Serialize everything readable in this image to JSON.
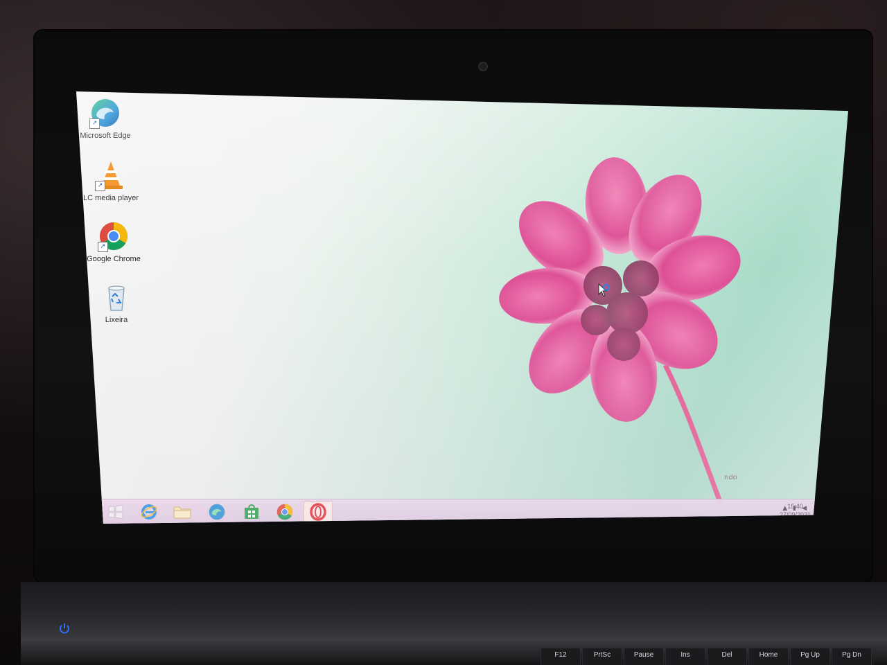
{
  "desktop": {
    "icons": [
      {
        "label": "Microsoft Edge",
        "icon": "edge-icon"
      },
      {
        "label": "LC media player",
        "icon": "vlc-icon"
      },
      {
        "label": "Google Chrome",
        "icon": "chrome-icon"
      },
      {
        "label": "Lixeira",
        "icon": "recycle-bin-icon"
      }
    ],
    "watermark": "ndo"
  },
  "taskbar": {
    "buttons": [
      {
        "name": "start-button",
        "icon": "windows-logo-icon"
      },
      {
        "name": "internet-explorer-button",
        "icon": "internet-explorer-icon"
      },
      {
        "name": "file-explorer-button",
        "icon": "folder-icon"
      },
      {
        "name": "edge-button",
        "icon": "edge-icon"
      },
      {
        "name": "store-button",
        "icon": "store-icon"
      },
      {
        "name": "chrome-button",
        "icon": "chrome-icon"
      },
      {
        "name": "opera-button",
        "icon": "opera-icon",
        "active": true
      }
    ],
    "clock_time": "15:40",
    "clock_date": "27/09/2021"
  },
  "keyboard": {
    "keys": [
      "F12",
      "PrtSc",
      "Pause",
      "Ins",
      "Del",
      "Home",
      "Pg Up",
      "Pg Dn"
    ]
  },
  "colors": {
    "wallpaper_green": "#a8dcc8",
    "flower_pink": "#e3579a",
    "taskbar": "#e4d2e6"
  }
}
